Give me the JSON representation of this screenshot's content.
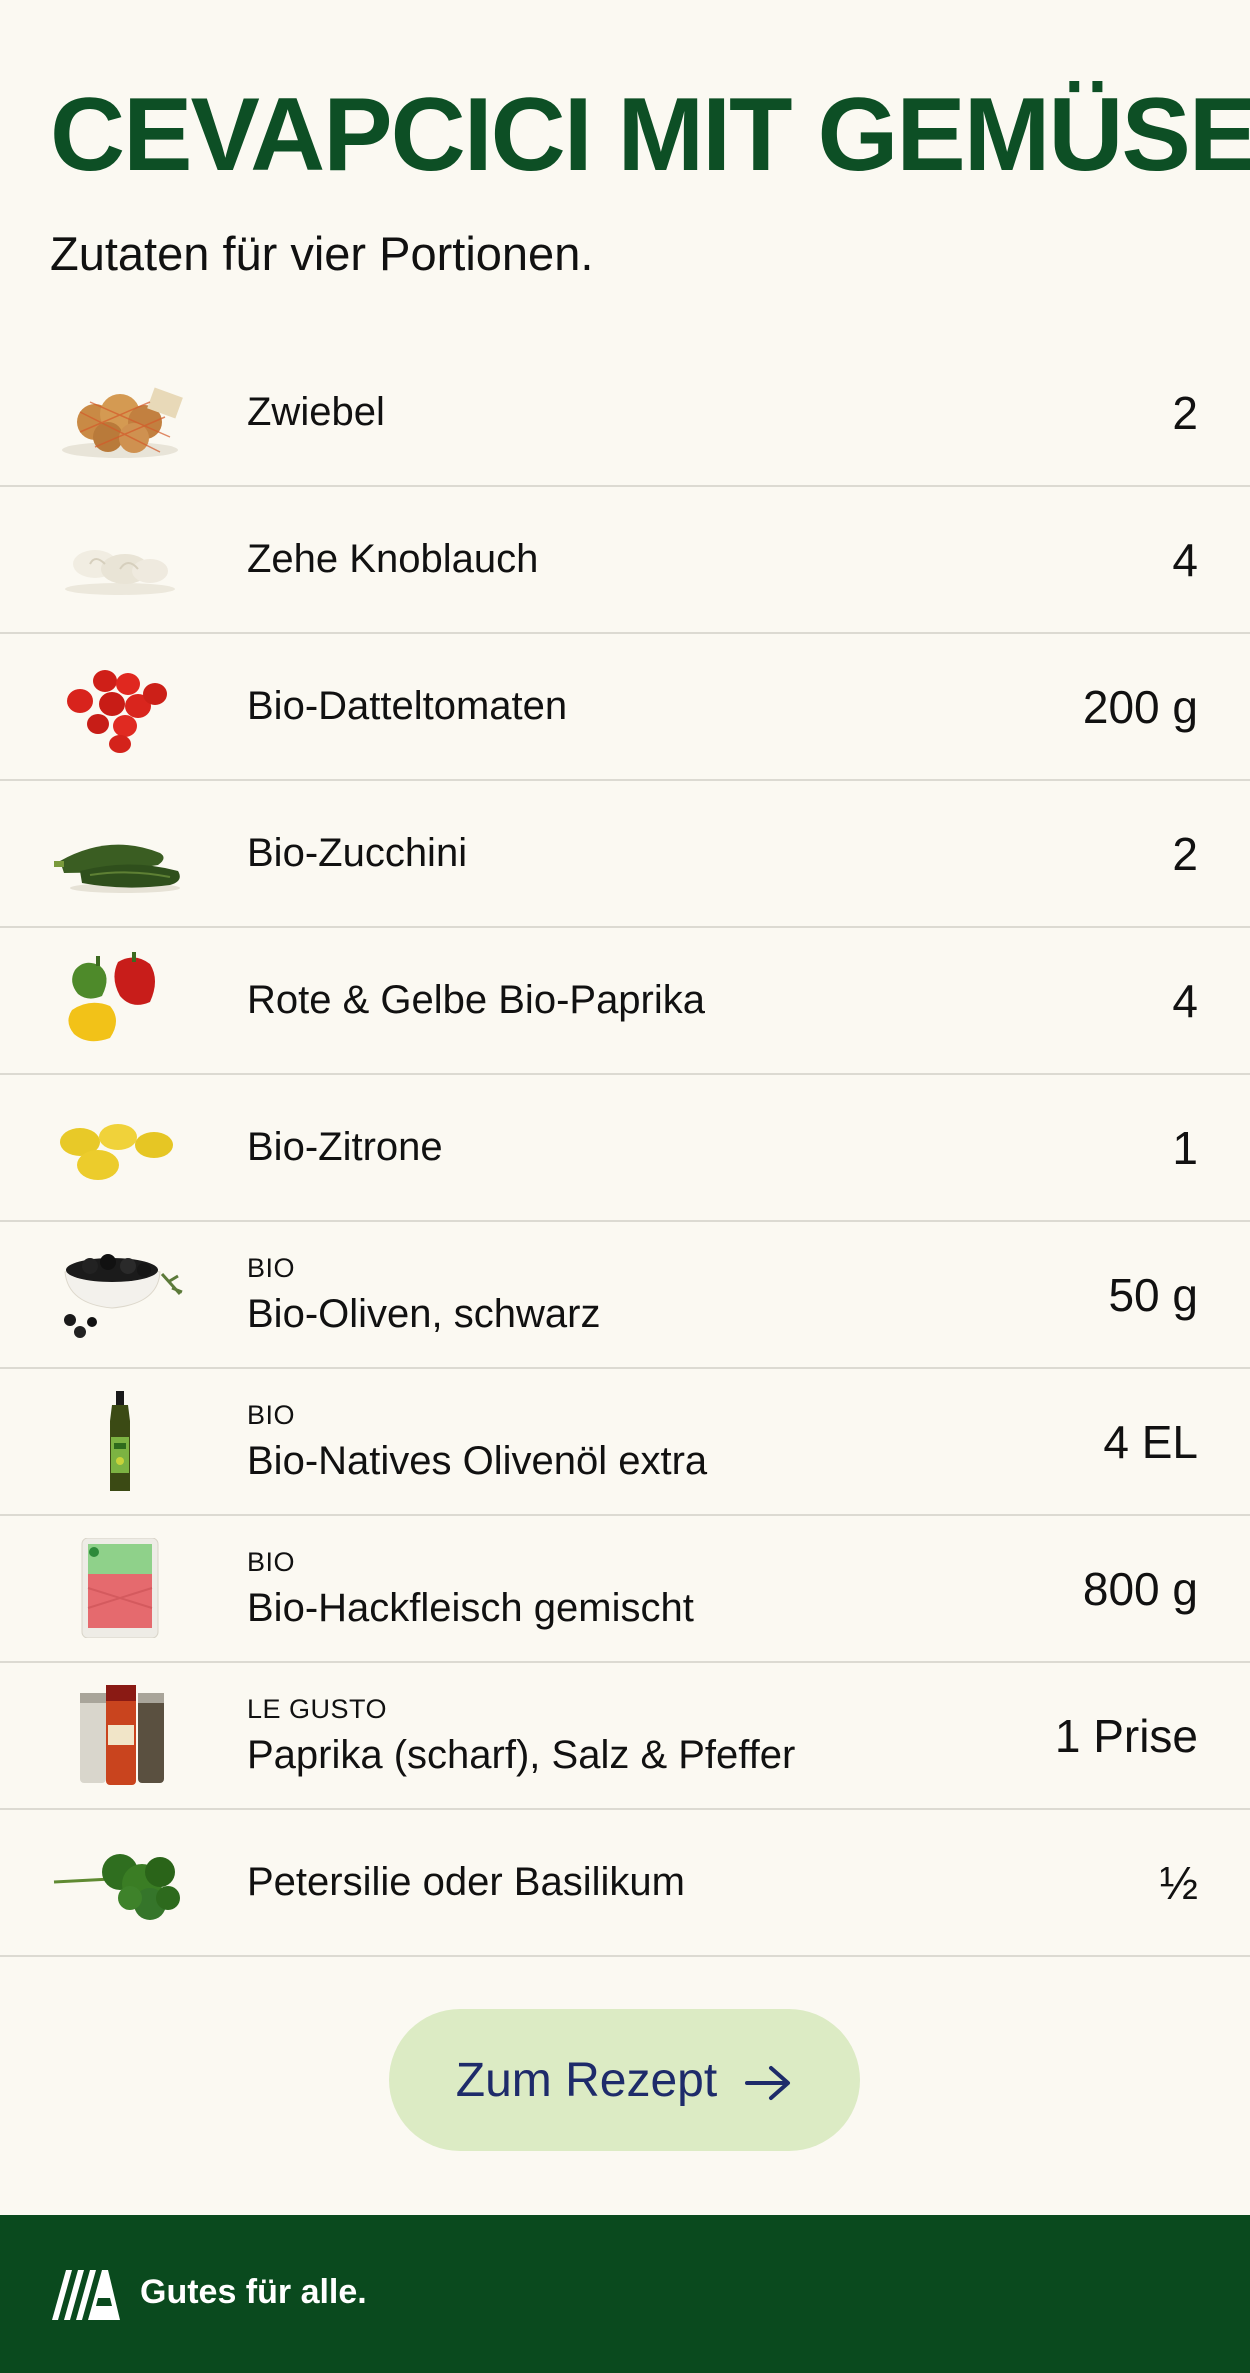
{
  "page": {
    "title": "CEVAPCICI MIT GEMÜSE",
    "subtitle": "Zutaten für vier Portionen."
  },
  "ingredients": [
    {
      "icon": "onion-net-icon",
      "brand": "",
      "name": "Zwiebel",
      "amount": "2"
    },
    {
      "icon": "garlic-icon",
      "brand": "",
      "name": "Zehe Knoblauch",
      "amount": "4"
    },
    {
      "icon": "cherry-tomatoes-icon",
      "brand": "",
      "name": "Bio-Datteltomaten",
      "amount": "200 g"
    },
    {
      "icon": "zucchini-icon",
      "brand": "",
      "name": "Bio-Zucchini",
      "amount": "2"
    },
    {
      "icon": "bell-peppers-icon",
      "brand": "",
      "name": "Rote & Gelbe Bio-Paprika",
      "amount": "4"
    },
    {
      "icon": "lemons-icon",
      "brand": "",
      "name": "Bio-Zitrone",
      "amount": "1"
    },
    {
      "icon": "black-olives-icon",
      "brand": "BIO",
      "name": "Bio-Oliven, schwarz",
      "amount": "50 g"
    },
    {
      "icon": "olive-oil-bottle-icon",
      "brand": "BIO",
      "name": "Bio-Natives Olivenöl extra",
      "amount": "4 EL"
    },
    {
      "icon": "minced-meat-package-icon",
      "brand": "BIO",
      "name": "Bio-Hackfleisch gemischt",
      "amount": "800 g"
    },
    {
      "icon": "spice-shakers-icon",
      "brand": "LE GUSTO",
      "name": "Paprika (scharf), Salz & Pfeffer",
      "amount": "1 Prise"
    },
    {
      "icon": "parsley-icon",
      "brand": "",
      "name": "Petersilie oder Basilikum",
      "amount": "½"
    }
  ],
  "cta": {
    "label": "Zum Rezept",
    "icon": "arrow-right-icon"
  },
  "footer": {
    "logo": "aldi-logo-icon",
    "slogan": "Gutes für alle."
  },
  "colors": {
    "title_green": "#0d4f25",
    "footer_green": "#0a4a1e",
    "button_bg": "#dcebc4",
    "button_text": "#1e2b6a",
    "background": "#fbf9f2"
  }
}
